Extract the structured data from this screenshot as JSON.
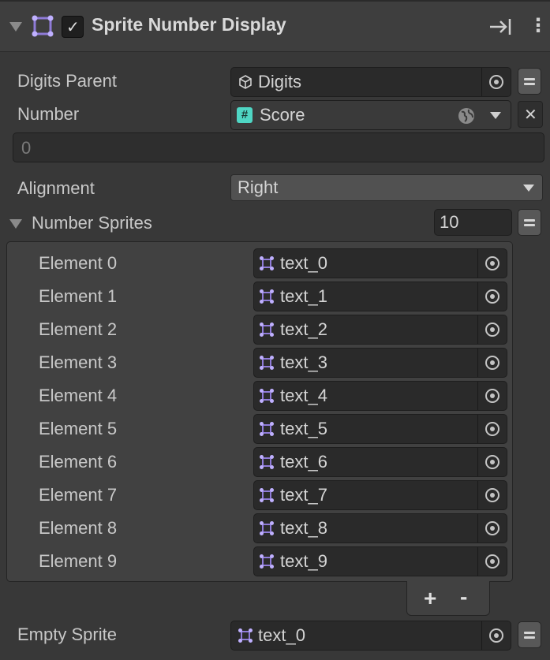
{
  "header": {
    "title": "Sprite Number Display",
    "enabled_check": "✓",
    "more_icon": "⋮"
  },
  "digits_parent": {
    "label": "Digits Parent",
    "value": "Digits"
  },
  "number": {
    "label": "Number",
    "value": "Score",
    "hash": "#",
    "clear_glyph": "✕",
    "text_value": "0"
  },
  "alignment": {
    "label": "Alignment",
    "value": "Right"
  },
  "number_sprites": {
    "label": "Number Sprites",
    "size": "10",
    "elements": [
      {
        "label": "Element 0",
        "value": "text_0"
      },
      {
        "label": "Element 1",
        "value": "text_1"
      },
      {
        "label": "Element 2",
        "value": "text_2"
      },
      {
        "label": "Element 3",
        "value": "text_3"
      },
      {
        "label": "Element 4",
        "value": "text_4"
      },
      {
        "label": "Element 5",
        "value": "text_5"
      },
      {
        "label": "Element 6",
        "value": "text_6"
      },
      {
        "label": "Element 7",
        "value": "text_7"
      },
      {
        "label": "Element 8",
        "value": "text_8"
      },
      {
        "label": "Element 9",
        "value": "text_9"
      }
    ],
    "add_label": "+",
    "remove_label": "-"
  },
  "empty_sprite": {
    "label": "Empty Sprite",
    "value": "text_0"
  },
  "colors": {
    "background": "#383838",
    "field": "#2a2a2a",
    "sprite_icon": "#8f7bd8",
    "hash_icon": "#4fd6c4"
  }
}
